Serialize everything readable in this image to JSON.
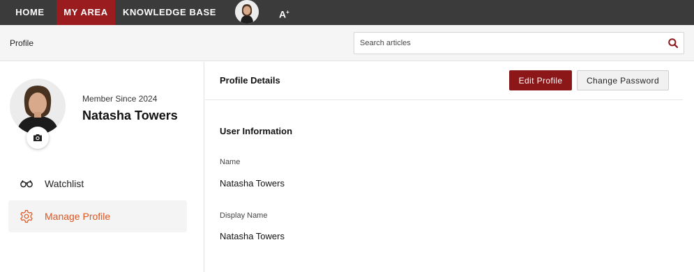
{
  "nav": {
    "home": "HOME",
    "my_area": "MY AREA",
    "knowledge_base": "KNOWLEDGE BASE",
    "accessibility": "A",
    "accessibility_sup": "+"
  },
  "breadcrumb": "Profile",
  "search": {
    "placeholder": "Search articles",
    "value": ""
  },
  "profile": {
    "member_since": "Member Since 2024",
    "name": "Natasha Towers"
  },
  "sidebar": {
    "items": [
      {
        "label": "Watchlist",
        "icon": "binoculars-icon"
      },
      {
        "label": "Manage Profile",
        "icon": "gear-icon",
        "active": true
      }
    ]
  },
  "main": {
    "title": "Profile Details",
    "edit_label": "Edit Profile",
    "password_label": "Change Password",
    "section_title": "User Information",
    "fields": [
      {
        "label": "Name",
        "value": "Natasha Towers"
      },
      {
        "label": "Display Name",
        "value": "Natasha Towers"
      }
    ]
  },
  "colors": {
    "nav_bg": "#3b3b3b",
    "nav_active": "#9b1c1f",
    "accent": "#8c1719",
    "active_link": "#e0541e"
  }
}
